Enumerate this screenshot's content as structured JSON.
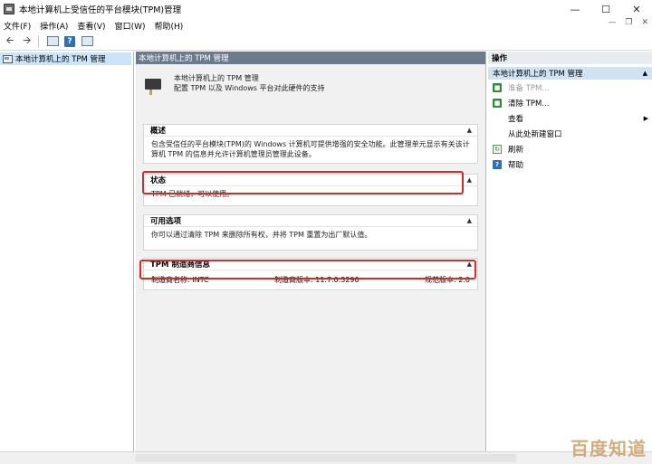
{
  "window": {
    "title": "本地计算机上受信任的平台模块(TPM)管理",
    "icon": "tpm-console-icon",
    "controls": {
      "minimize": "—",
      "maximize": "☐",
      "close": "✕"
    },
    "mdi_controls": {
      "minimize": "—",
      "restore": "❐",
      "close": "✕"
    }
  },
  "menu": {
    "items": [
      "文件(F)",
      "操作(A)",
      "查看(V)",
      "窗口(W)",
      "帮助(H)"
    ]
  },
  "toolbar": {
    "back": "🡨",
    "forward": "🡪"
  },
  "tree": {
    "items": [
      {
        "label": "本地计算机上的 TPM 管理"
      }
    ]
  },
  "center": {
    "header": "本地计算机上的 TPM 管理",
    "intro": {
      "line1": "本地计算机上的 TPM 管理",
      "line2": "配置 TPM 以及 Windows 平台对此硬件的支持"
    },
    "overview": {
      "title": "概述",
      "text": "包含受信任的平台模块(TPM)的 Windows 计算机可提供增强的安全功能。此管理单元显示有关该计算机 TPM 的信息并允许计算机管理员管理此设备。"
    },
    "status": {
      "title": "状态",
      "text": "TPM 已就绪，可以使用。"
    },
    "options": {
      "title": "可用选项",
      "text": "你可以通过清除 TPM 来删除所有权，并将 TPM 重置为出厂默认值。"
    },
    "vendor": {
      "title": "TPM 制造商信息",
      "name": "制造商名称: INTC",
      "version": "制造商版本: 11.7.0.3290",
      "spec": "规范版本: 2.0"
    }
  },
  "actions": {
    "header": "操作",
    "section": "本地计算机上的 TPM 管理",
    "items": [
      {
        "label": "准备 TPM...",
        "icon": "tpm-green-icon",
        "enabled": false
      },
      {
        "label": "清除 TPM...",
        "icon": "tpm-green-icon",
        "enabled": true
      },
      {
        "label": "查看",
        "icon": "",
        "enabled": true
      },
      {
        "label": "从此处新建窗口",
        "icon": "",
        "enabled": true
      },
      {
        "label": "刷新",
        "icon": "refresh-icon",
        "enabled": true
      },
      {
        "label": "帮助",
        "icon": "help-icon",
        "enabled": true
      }
    ]
  },
  "watermark": "百度知道",
  "colors": {
    "center_header": "#6b7b8c",
    "selection": "#cce4f7",
    "highlight_box": "#d42a2a"
  }
}
